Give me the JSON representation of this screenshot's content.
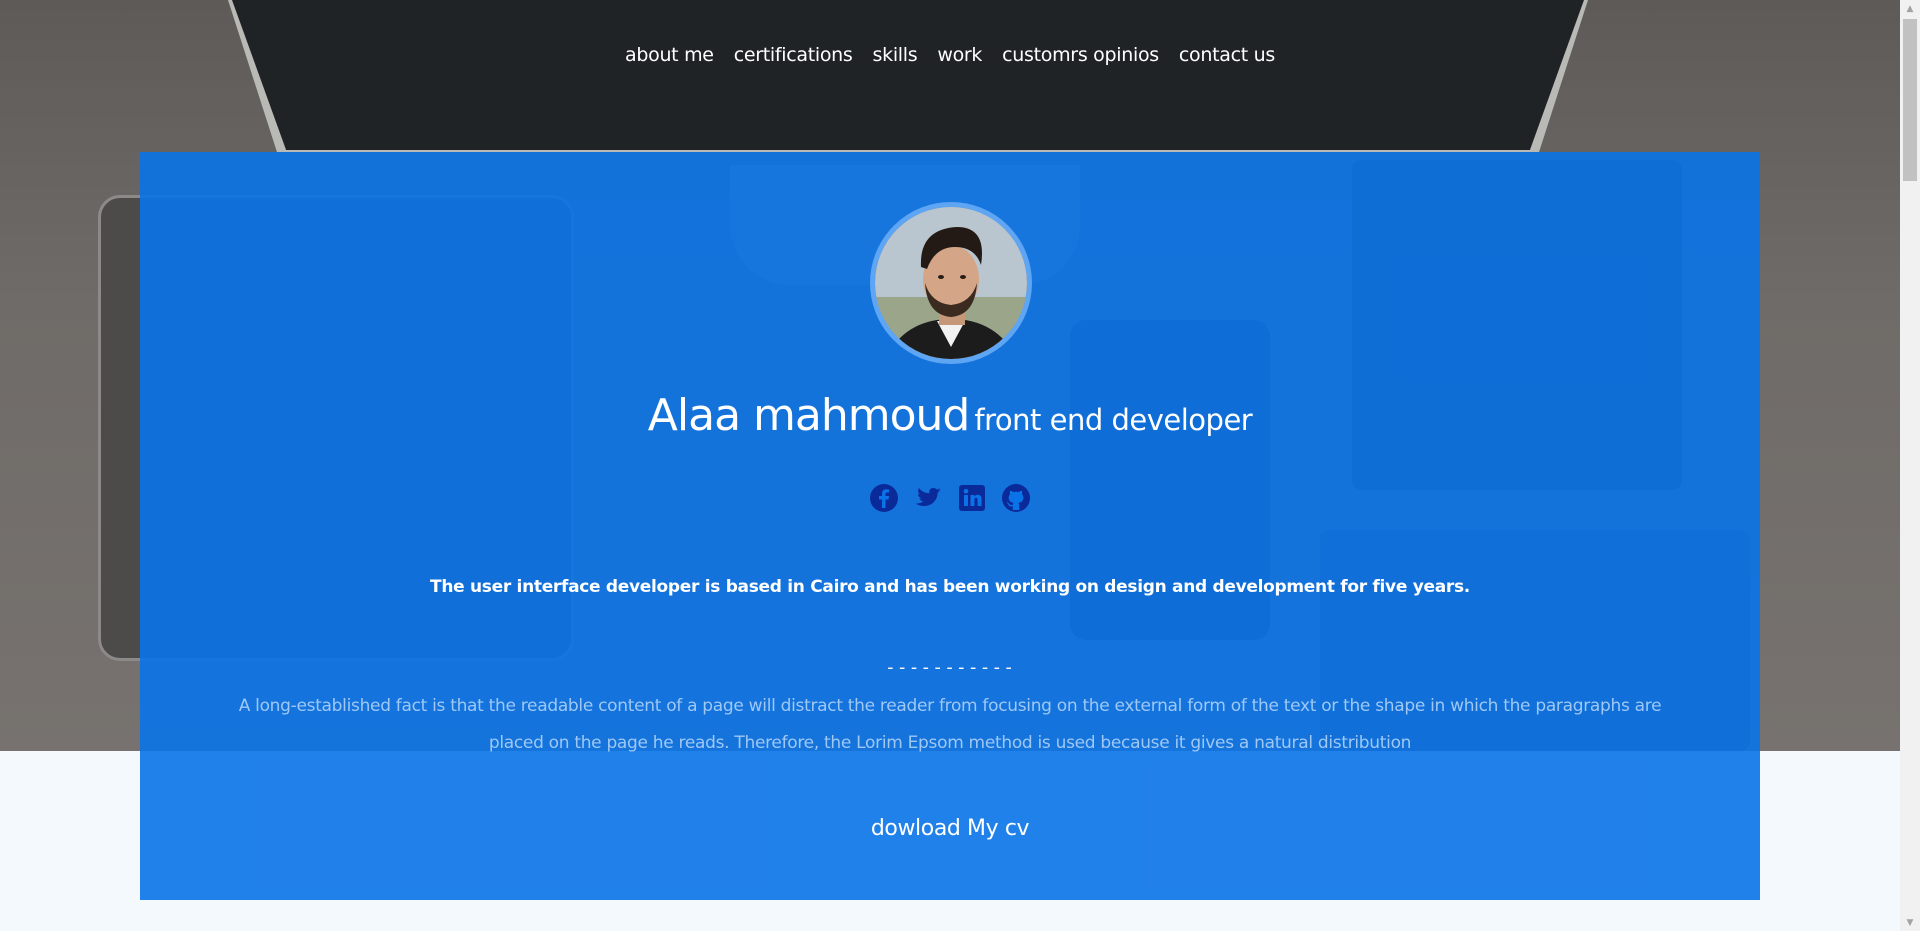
{
  "nav": {
    "items": [
      "about me",
      "certifications",
      "skills",
      "work",
      "customrs opinios",
      "contact us"
    ]
  },
  "hero": {
    "name": "Alaa mahmoud",
    "role": "front end developer",
    "tagline": "The user interface developer is based in Cairo and has been working on design and development for five years.",
    "divider": "-----------",
    "description": "A long-established fact is that the readable content of a page will distract the reader from focusing on the external form of the text or the shape in which the paragraphs are placed on the page he reads. Therefore, the Lorim Epsom method is used because it gives a natural distribution",
    "cv_button": "dowload My cv"
  },
  "socials": [
    "facebook-icon",
    "twitter-icon",
    "linkedin-icon",
    "github-icon"
  ],
  "colors": {
    "card": "#0a73e8",
    "social_icon": "#0a2a9a",
    "description_text": "#9ec8f6"
  },
  "scrollbar": {
    "up": "▲",
    "down": "▼"
  }
}
